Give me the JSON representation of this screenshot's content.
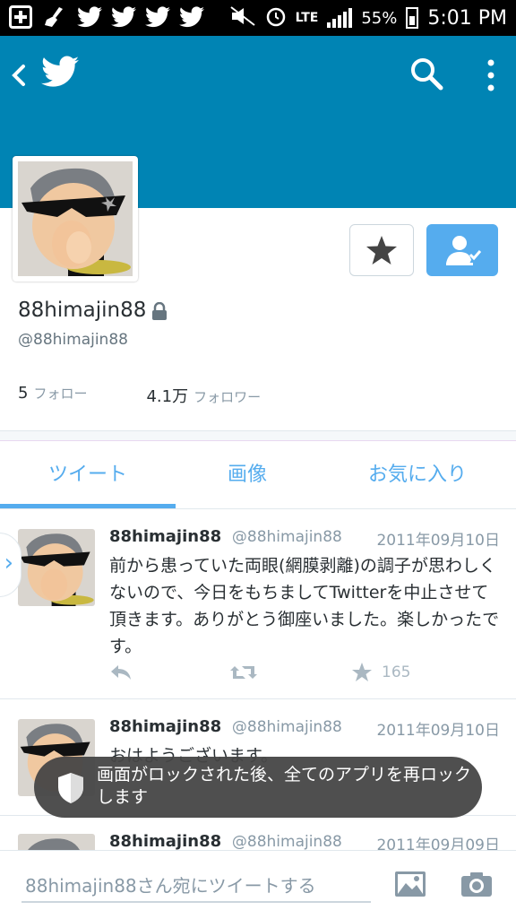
{
  "status_bar": {
    "network": "LTE",
    "battery": "55%",
    "time": "5:01 PM"
  },
  "profile": {
    "display_name": "88himajin88",
    "handle": "@88himajin88",
    "following_count": "5",
    "following_label": "フォロー",
    "followers_count": "4.1万",
    "followers_label": "フォロワー"
  },
  "tabs": [
    {
      "label": "ツイート",
      "active": true
    },
    {
      "label": "画像",
      "active": false
    },
    {
      "label": "お気に入り",
      "active": false
    }
  ],
  "tweets": [
    {
      "name": "88himajin88",
      "handle": "@88himajin88",
      "date": "2011年09月10日",
      "text": "前から患っていた両眼(網膜剥離)の調子が思わしくないので、今日をもちましてTwitterを中止させて頂きます。ありがとう御座いました。楽しかったです。",
      "favorites": "165"
    },
    {
      "name": "88himajin88",
      "handle": "@88himajin88",
      "date": "2011年09月10日",
      "text": "おはようございます。"
    },
    {
      "name": "88himajin88",
      "handle": "@88himajin88",
      "date": "2011年09月09日"
    }
  ],
  "toast": {
    "text": "画面がロックされた後、全てのアプリを再ロックします"
  },
  "compose": {
    "placeholder": "88himajin88さん宛にツイートする"
  },
  "colors": {
    "banner": "#0084b4",
    "accent": "#55acee"
  }
}
